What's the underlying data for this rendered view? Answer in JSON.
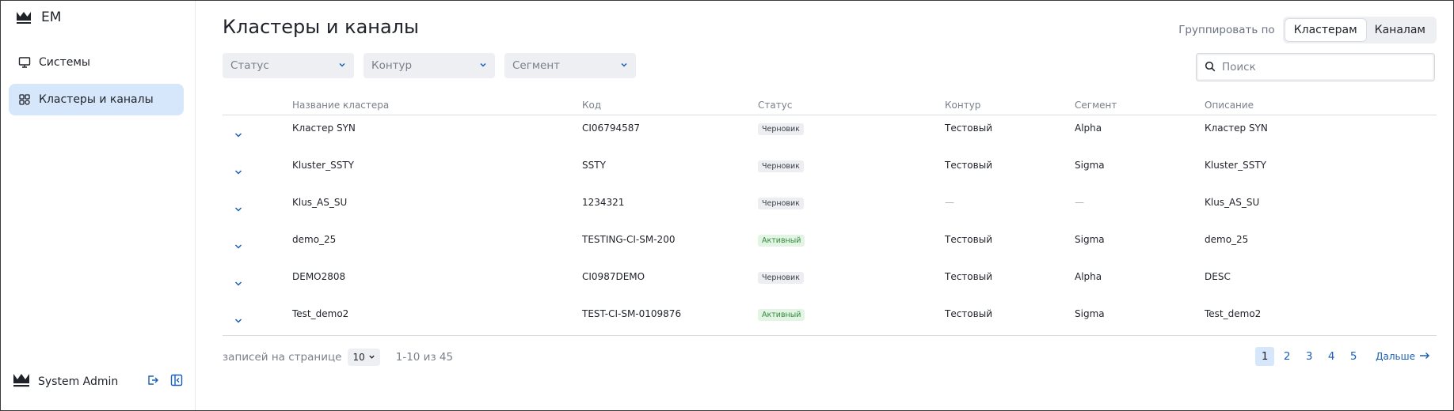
{
  "app": {
    "name": "EM"
  },
  "sidebar": {
    "items": [
      {
        "label": "Системы",
        "icon": "monitor-icon"
      },
      {
        "label": "Кластеры и каналы",
        "icon": "grid-icon"
      }
    ],
    "user": {
      "name": "System Admin"
    }
  },
  "page": {
    "title": "Кластеры и каналы"
  },
  "group_by": {
    "label": "Группировать по",
    "options": [
      "Кластерам",
      "Каналам"
    ],
    "selected": "Кластерам"
  },
  "filters": [
    {
      "label": "Статус"
    },
    {
      "label": "Контур"
    },
    {
      "label": "Сегмент"
    }
  ],
  "search": {
    "placeholder": "Поиск"
  },
  "table": {
    "columns": [
      "Название кластера",
      "Код",
      "Статус",
      "Контур",
      "Сегмент",
      "Описание"
    ],
    "rows": [
      {
        "name": "Кластер SYN",
        "code": "CI06794587",
        "status": "Черновик",
        "contour": "Тестовый",
        "segment": "Alpha",
        "description": "Кластер SYN"
      },
      {
        "name": "Kluster_SSTY",
        "code": "SSTY",
        "status": "Черновик",
        "contour": "Тестовый",
        "segment": "Sigma",
        "description": "Kluster_SSTY"
      },
      {
        "name": "Klus_AS_SU",
        "code": "1234321",
        "status": "Черновик",
        "contour": "—",
        "segment": "—",
        "description": "Klus_AS_SU"
      },
      {
        "name": "demo_25",
        "code": "TESTING-CI-SM-200",
        "status": "Активный",
        "contour": "Тестовый",
        "segment": "Sigma",
        "description": "demo_25"
      },
      {
        "name": "DEMO2808",
        "code": "CI0987DEMO",
        "status": "Черновик",
        "contour": "Тестовый",
        "segment": "Alpha",
        "description": "DESC"
      },
      {
        "name": "Test_demo2",
        "code": "TEST-CI-SM-0109876",
        "status": "Активный",
        "contour": "Тестовый",
        "segment": "Sigma",
        "description": "Test_demo2"
      }
    ]
  },
  "pagination": {
    "per_page_label": "записей на странице",
    "per_page_value": "10",
    "range": "1-10 из 45",
    "pages": [
      "1",
      "2",
      "3",
      "4",
      "5"
    ],
    "current_page": "1",
    "next_label": "Дальше"
  },
  "colors": {
    "accent": "#1a5fb4",
    "active_nav": "#d6e6fb",
    "badge_active_text": "#2e8b3a",
    "badge_active_bg": "#e3f4e4",
    "badge_draft_bg": "#eceef1"
  }
}
